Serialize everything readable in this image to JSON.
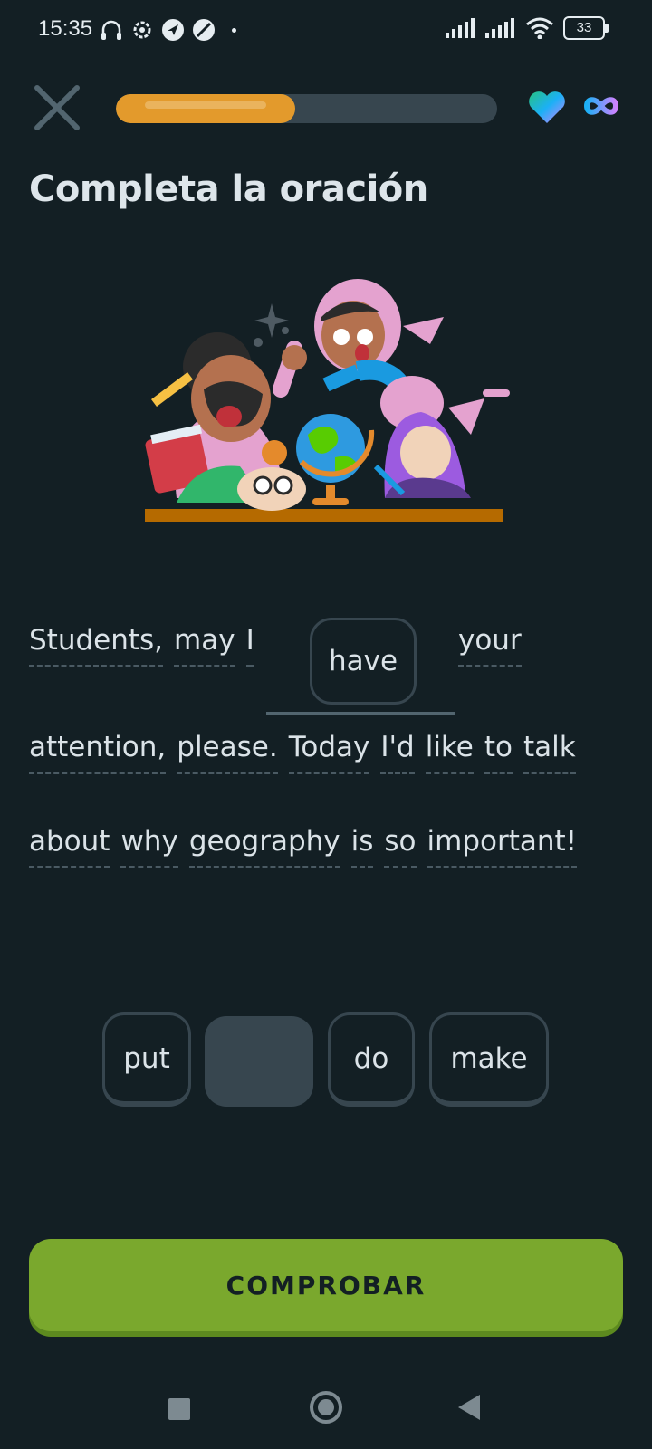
{
  "status_bar": {
    "time": "15:35",
    "battery": "33"
  },
  "header": {
    "progress_percent": 47,
    "hearts": "infinite"
  },
  "prompt": {
    "title": "Completa la oración"
  },
  "sentence": {
    "line1": [
      "Students,",
      "may",
      "I"
    ],
    "chosen_word": "have",
    "line1_after": "your",
    "line2": [
      "attention,",
      "please.",
      "Today",
      "I'd",
      "like",
      "to",
      "talk"
    ],
    "line3": [
      "about",
      "why",
      "geography",
      "is",
      "so",
      "important!"
    ]
  },
  "word_bank": {
    "option_1": "put",
    "option_3": "do",
    "option_4": "make"
  },
  "actions": {
    "check_label": "COMPROBAR"
  },
  "colors": {
    "background": "#131f24",
    "progress": "#e39a2c",
    "check_button": "#7aa82d",
    "chip_border": "#37464f"
  }
}
